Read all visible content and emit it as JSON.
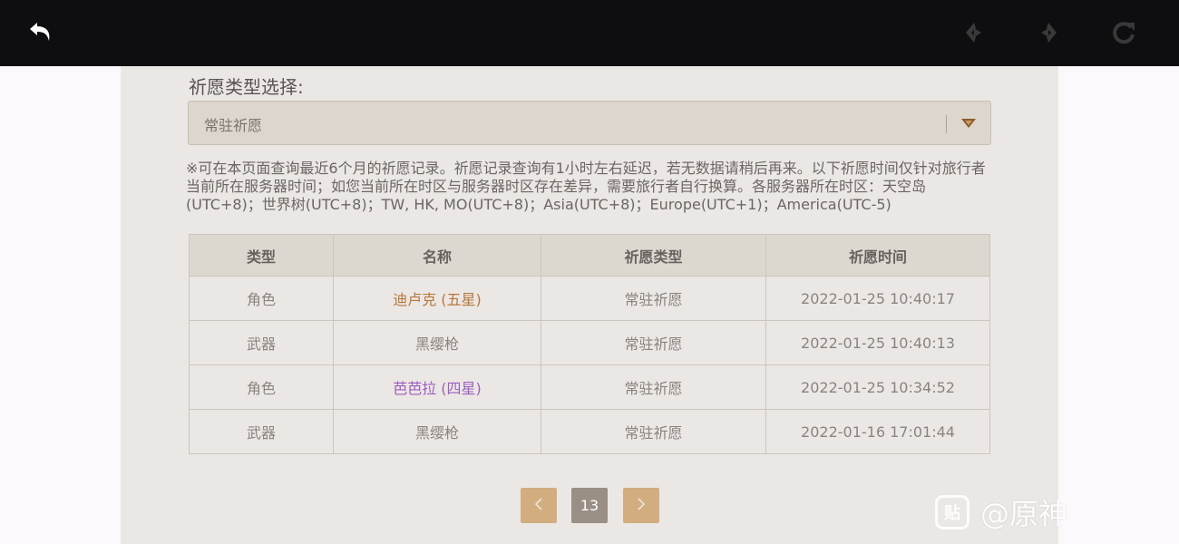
{
  "topbar": {
    "back_icon": "back-arrow-icon",
    "prev_icon": "nav-back-icon",
    "next_icon": "nav-forward-icon",
    "refresh_icon": "refresh-icon"
  },
  "selector": {
    "label": "祈愿类型选择:",
    "value": "常驻祈愿"
  },
  "notice": "※可在本页面查询最近6个月的祈愿记录。祈愿记录查询有1小时左右延迟，若无数据请稍后再来。以下祈愿时间仅针对旅行者当前所在服务器时间；如您当前所在时区与服务器时区存在差异，需要旅行者自行换算。各服务器所在时区：天空岛(UTC+8)；世界树(UTC+8)；TW, HK, MO(UTC+8)；Asia(UTC+8)；Europe(UTC+1)；America(UTC-5)",
  "table": {
    "headers": [
      "类型",
      "名称",
      "祈愿类型",
      "祈愿时间"
    ],
    "rows": [
      {
        "type": "角色",
        "name": "迪卢克 (五星)",
        "wish": "常驻祈愿",
        "time": "2022-01-25 10:40:17",
        "rarity": "five"
      },
      {
        "type": "武器",
        "name": "黑缨枪",
        "wish": "常驻祈愿",
        "time": "2022-01-25 10:40:13",
        "rarity": "three"
      },
      {
        "type": "角色",
        "name": "芭芭拉 (四星)",
        "wish": "常驻祈愿",
        "time": "2022-01-25 10:34:52",
        "rarity": "four"
      },
      {
        "type": "武器",
        "name": "黑缨枪",
        "wish": "常驻祈愿",
        "time": "2022-01-16 17:01:44",
        "rarity": "three"
      }
    ]
  },
  "pagination": {
    "current_page": "13"
  },
  "colors": {
    "five_star": "#b5773c",
    "four_star": "#9c5dbf",
    "page_button": "#d2ad80",
    "page_current": "#9a8f84"
  },
  "watermark": {
    "logo_text": "贴",
    "text": "@原神"
  }
}
